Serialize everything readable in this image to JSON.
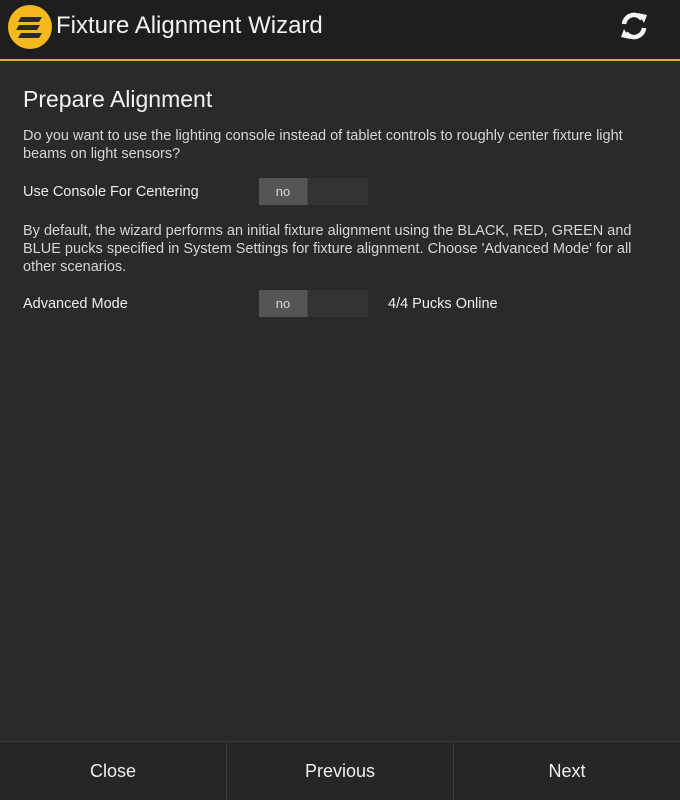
{
  "header": {
    "title": "Fixture Alignment Wizard",
    "logo_icon": "app-logo-icon",
    "refresh_icon": "refresh-icon",
    "accent_color": "#e2a83a"
  },
  "main": {
    "section_title": "Prepare Alignment",
    "console_question": "Do you want to use the lighting console instead of tablet controls to roughly center fixture light beams on light sensors?",
    "console_label": "Use Console For Centering",
    "console_value": "no",
    "advanced_description": "By default, the wizard performs an initial fixture alignment using the BLACK, RED, GREEN and BLUE pucks specified in System Settings for fixture alignment. Choose 'Advanced Mode' for all other scenarios.",
    "advanced_label": "Advanced Mode",
    "advanced_value": "no",
    "pucks_status": "4/4 Pucks Online"
  },
  "footer": {
    "close_label": "Close",
    "previous_label": "Previous",
    "next_label": "Next"
  }
}
